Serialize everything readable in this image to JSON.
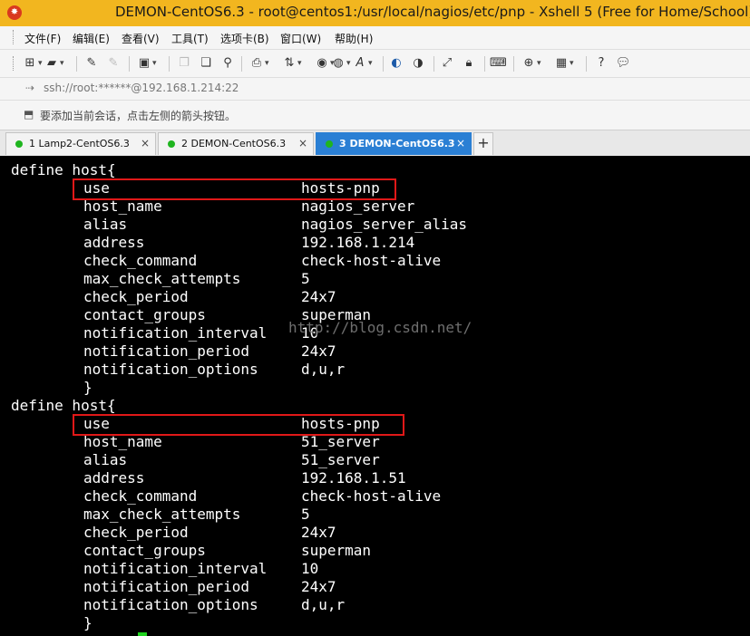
{
  "window": {
    "title": "DEMON-CentOS6.3 - root@centos1:/usr/local/nagios/etc/pnp - Xshell 5 (Free for Home/School)",
    "app_icon": "xshell-logo-icon"
  },
  "menu": [
    "文件(F)",
    "编辑(E)",
    "查看(V)",
    "工具(T)",
    "选项卡(B)",
    "窗口(W)",
    "帮助(H)"
  ],
  "toolbar_icons": [
    "new-session-icon",
    "open-folder-icon",
    "edit-icon",
    "disabled-icon",
    "properties-icon",
    "copy-icon",
    "paste-icon",
    "find-icon",
    "print-icon",
    "transfer-icon",
    "color-scheme-icon",
    "globe-icon",
    "font-icon",
    "xftp-icon",
    "script-icon",
    "fullscreen-icon",
    "lock-icon",
    "keyboard-icon",
    "add-pane-icon",
    "layout-icon",
    "help-icon",
    "chat-icon"
  ],
  "address": {
    "text": "ssh://root:******@192.168.1.214:22"
  },
  "hint": {
    "text": "要添加当前会话，点击左侧的箭头按钮。"
  },
  "tabs": [
    {
      "label": "1 Lamp2-CentOS6.3",
      "active": false
    },
    {
      "label": "2 DEMON-CentOS6.3",
      "active": false
    },
    {
      "label": "3 DEMON-CentOS6.3",
      "active": true
    }
  ],
  "tab_close": "×",
  "tab_add": "+",
  "terminal": {
    "host1_header": "define host{",
    "host1": [
      {
        "key": "use",
        "val": "hosts-pnp"
      },
      {
        "key": "host_name",
        "val": "nagios_server"
      },
      {
        "key": "alias",
        "val": "nagios_server_alias"
      },
      {
        "key": "address",
        "val": "192.168.1.214"
      },
      {
        "key": "check_command",
        "val": "check-host-alive"
      },
      {
        "key": "max_check_attempts",
        "val": "5"
      },
      {
        "key": "check_period",
        "val": "24x7"
      },
      {
        "key": "contact_groups",
        "val": "superman"
      },
      {
        "key": "notification_interval",
        "val": "10"
      },
      {
        "key": "notification_period",
        "val": "24x7"
      },
      {
        "key": "notification_options",
        "val": "d,u,r"
      }
    ],
    "host1_close": "}",
    "host2_header": "define host{",
    "host2": [
      {
        "key": "use",
        "val": "hosts-pnp"
      },
      {
        "key": "host_name",
        "val": "51_server"
      },
      {
        "key": "alias",
        "val": "51_server"
      },
      {
        "key": "address",
        "val": "192.168.1.51"
      },
      {
        "key": "check_command",
        "val": "check-host-alive"
      },
      {
        "key": "max_check_attempts",
        "val": "5"
      },
      {
        "key": "check_period",
        "val": "24x7"
      },
      {
        "key": "contact_groups",
        "val": "superman"
      },
      {
        "key": "notification_interval",
        "val": "10"
      },
      {
        "key": "notification_period",
        "val": "24x7"
      },
      {
        "key": "notification_options",
        "val": "d,u,r"
      }
    ],
    "host2_close": "}",
    "watermark": "http://blog.csdn.net/"
  },
  "colors": {
    "titlebar": "#f2b61f",
    "active_tab": "#2a7fd4",
    "highlight": "#e01818",
    "cursor": "#1fd41f"
  }
}
